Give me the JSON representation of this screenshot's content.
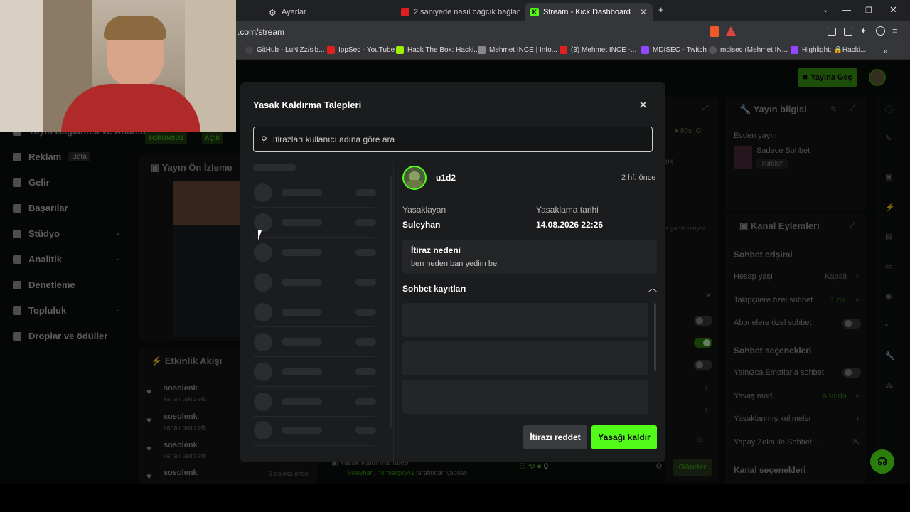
{
  "browser": {
    "tabs": [
      {
        "label": "Ayarlar"
      },
      {
        "label": "2 saniyede nasıl bağcık bağlanır - Yo"
      },
      {
        "label": "Stream - Kick Dashboard"
      }
    ],
    "url": ".com/stream",
    "bookmarks": [
      "GitHub - LuNiZz/sib...",
      "IppSec - YouTube",
      "Hack The Box: Hacki...",
      "Mehmet INCE | Info...",
      "(3) Mehmet INCE -...",
      "MDISEC - Twitch",
      "mdisec (Mehmet IN...",
      "Highlight: 🔒Hacki..."
    ]
  },
  "sidebar": {
    "partial_label": "Yayın Bağlantısı ve Anahtar",
    "items": [
      {
        "label": "Reklam",
        "badge": "Beta"
      },
      {
        "label": "Gelir"
      },
      {
        "label": "Başarılar"
      },
      {
        "label": "Stüdyo"
      },
      {
        "label": "Analitik"
      },
      {
        "label": "Denetleme"
      },
      {
        "label": "Topluluk"
      },
      {
        "label": "Droplar ve ödüller"
      }
    ]
  },
  "header": {
    "go_live": "Yayına Geç"
  },
  "status_tags": [
    "SORUNSUZ",
    "AÇIK"
  ],
  "preview": {
    "title": "Yayın Ön İzleme"
  },
  "activity": {
    "title": "Etkinlik Akışı",
    "items": [
      {
        "user": "sosolenk",
        "action": "kanalı takip etti"
      },
      {
        "user": "sosolenk",
        "action": "kanalı takip etti"
      },
      {
        "user": "sosolenk",
        "action": "kanalı takip etti"
      },
      {
        "user": "sosolenk",
        "action": "",
        "time": "3 dakika önce"
      }
    ]
  },
  "chat_fragments": {
    "tag": "80s_Gl",
    "fragment1": "nk",
    "fragment2": "s yanıt veriyor",
    "send": "Gönder",
    "count": "0",
    "ban_user": "Suleyhan",
    "ban_by": "normalguy41",
    "ban_suffix": "tarafından yapılan",
    "ban_title": "Yasak Kaldırma Talebi"
  },
  "stream_info": {
    "title": "Yayın bilgisi",
    "source": "Evden yayın",
    "category": "Sadece Sohbet",
    "language": "Turkish"
  },
  "channel_actions": {
    "title": "Kanal Eylemleri",
    "chat_access": "Sohbet erişimi",
    "account_age": {
      "label": "Hesap yaşı",
      "value": "Kapalı"
    },
    "followers_only": {
      "label": "Takipçilere özel sohbet",
      "value": "1 dk."
    },
    "subscribers_only": {
      "label": "Abonelere özel sohbet"
    },
    "chat_options": "Sohbet seçenekleri",
    "emotes_only": {
      "label": "Yalnızca Emotlarla sohbet"
    },
    "slow_mode": {
      "label": "Yavaş mod",
      "value": "Anında"
    },
    "banned_words": {
      "label": "Yasaklanmış kelimeler"
    },
    "ai_chat": {
      "label": "Yapay Zeka ile Sohbet..."
    },
    "channel_options": "Kanal seçenekleri"
  },
  "modal": {
    "title": "Yasak Kaldırma Talepleri",
    "search_placeholder": "İtirazları kullanıcı adına göre ara",
    "selected": {
      "username": "u1d2",
      "time_ago": "2 hf. önce",
      "banned_by_label": "Yasaklayan",
      "banned_by": "Suleyhan",
      "ban_date_label": "Yasaklama tarihi",
      "ban_date": "14.08.2026 22:26",
      "reason_label": "İtiraz nedeni",
      "reason": "ben neden ban yedim be",
      "logs_label": "Sohbet kayıtları"
    },
    "reject_button": "İtirazı reddet",
    "unban_button": "Yasağı kaldır"
  },
  "colors": {
    "accent": "#53fc18",
    "background": "#0b0c0d",
    "modal": "#1b1c1e"
  }
}
